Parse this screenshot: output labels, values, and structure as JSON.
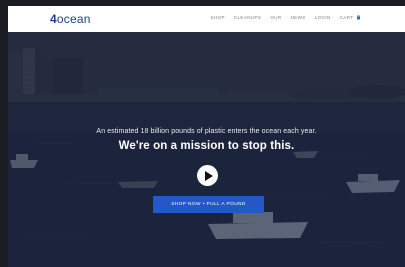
{
  "header": {
    "logo_number": "4",
    "logo_word": "ocean",
    "nav": [
      "SHOP",
      "CLEANUPS",
      "OUR",
      "NEWS",
      "LOGIN",
      "CART"
    ],
    "cart_icon": "bag-icon"
  },
  "hero": {
    "stat": "An estimated 18 billion pounds of plastic enters the ocean each year.",
    "headline": "We're on a mission to stop this.",
    "play_icon": "play-icon",
    "cta_label": "SHOP NOW • PULL A POUND"
  },
  "colors": {
    "brand": "#1d3f8f",
    "cta": "#2657c8",
    "header_bg": "#ffffff"
  }
}
